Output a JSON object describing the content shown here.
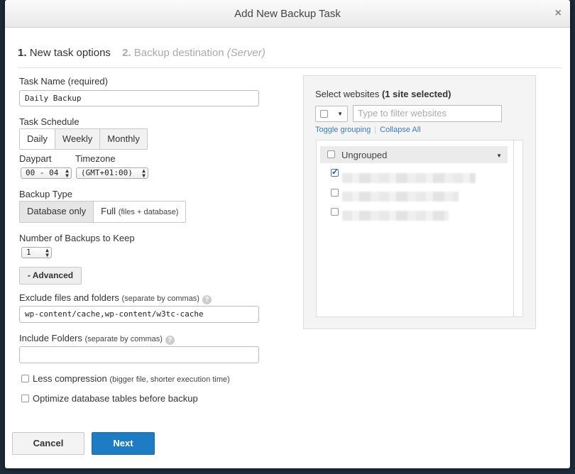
{
  "dialog": {
    "title": "Add New Backup Task",
    "close_symbol": "×"
  },
  "steps": {
    "step1_number": "1.",
    "step1_label": "New task options",
    "step2_number": "2.",
    "step2_label": "Backup destination",
    "step2_hint": "(Server)"
  },
  "form": {
    "task_name_label": "Task Name (required)",
    "task_name_value": "Daily Backup",
    "schedule_label": "Task Schedule",
    "schedule_options": [
      "Daily",
      "Weekly",
      "Monthly"
    ],
    "schedule_selected": "Daily",
    "daypart_label": "Daypart",
    "daypart_value": "00 - 04",
    "timezone_label": "Timezone",
    "timezone_value": "(GMT+01:00)",
    "backup_type_label": "Backup Type",
    "backup_type_db": "Database only",
    "backup_type_full": "Full",
    "backup_type_full_hint": "(files + database)",
    "keep_label": "Number of Backups to Keep",
    "keep_value": "1",
    "advanced_button": "- Advanced",
    "exclude_label": "Exclude files and folders",
    "exclude_hint": "(separate by commas)",
    "exclude_value": "wp-content/cache,wp-content/w3tc-cache",
    "include_label": "Include Folders",
    "include_hint": "(separate by commas)",
    "include_value": "",
    "help_symbol": "?",
    "less_compression_label": "Less compression",
    "less_compression_hint": "(bigger file, shorter execution time)",
    "less_compression_checked": false,
    "optimize_label": "Optimize database tables before backup",
    "optimize_checked": false
  },
  "websites": {
    "title_prefix": "Select websites",
    "title_count": "(1 site selected)",
    "filter_placeholder": "Type to filter websites",
    "toggle_grouping": "Toggle grouping",
    "collapse_all": "Collapse All",
    "group_name": "Ungrouped",
    "sites": [
      {
        "checked": true
      },
      {
        "checked": false
      },
      {
        "checked": false
      }
    ]
  },
  "footer": {
    "cancel": "Cancel",
    "next": "Next"
  },
  "colors": {
    "primary": "#1d7cc4",
    "link": "#3a7bc0",
    "backdrop": "#1d2a38"
  }
}
